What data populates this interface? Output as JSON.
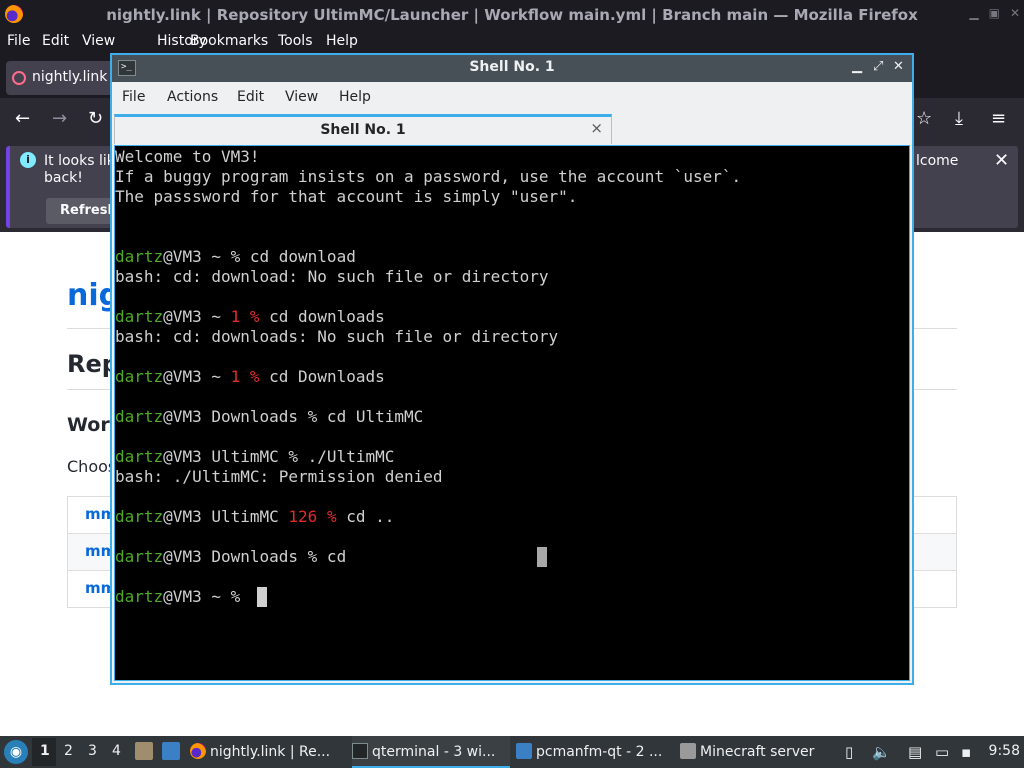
{
  "firefox": {
    "window_title": "nightly.link | Repository UltimMC/Launcher | Workflow main.yml | Branch main — Mozilla Firefox",
    "menu": [
      "File",
      "Edit",
      "View",
      "History",
      "Bookmarks",
      "Tools",
      "Help"
    ],
    "tab_label": "nightly.link |",
    "notice": {
      "text_line1": "It looks lik",
      "text_line2": "back!",
      "text_right": "lcome",
      "refresh_label": "Refresh"
    },
    "page": {
      "title": "nig",
      "repo_heading": "Rep",
      "workflow_heading": "Work",
      "choose_text": "Choos",
      "rows": [
        "mm",
        "mm",
        "mm"
      ]
    }
  },
  "terminal": {
    "window_title": "Shell No. 1",
    "menu": [
      "File",
      "Actions",
      "Edit",
      "View",
      "Help"
    ],
    "tab_label": "Shell No. 1",
    "tab_close": "×",
    "lines": [
      [
        {
          "t": "Welcome to VM3!",
          "k": "c"
        }
      ],
      [
        {
          "t": "If a buggy program insists on a password, use the account `user`.",
          "k": "c"
        }
      ],
      [
        {
          "t": "The passsword for that account is simply \"user\".",
          "k": "c"
        }
      ],
      [],
      [],
      [
        {
          "t": "dartz",
          "k": "u"
        },
        {
          "t": "@VM3 ~ % cd download",
          "k": "c"
        }
      ],
      [
        {
          "t": "bash: cd: download: No such file or directory",
          "k": "c"
        }
      ],
      [],
      [
        {
          "t": "dartz",
          "k": "u"
        },
        {
          "t": "@VM3 ~ ",
          "k": "c"
        },
        {
          "t": "1 %",
          "k": "e"
        },
        {
          "t": " cd downloads",
          "k": "c"
        }
      ],
      [
        {
          "t": "bash: cd: downloads: No such file or directory",
          "k": "c"
        }
      ],
      [],
      [
        {
          "t": "dartz",
          "k": "u"
        },
        {
          "t": "@VM3 ~ ",
          "k": "c"
        },
        {
          "t": "1 %",
          "k": "e"
        },
        {
          "t": " cd Downloads",
          "k": "c"
        }
      ],
      [],
      [
        {
          "t": "dartz",
          "k": "u"
        },
        {
          "t": "@VM3 Downloads % cd UltimMC",
          "k": "c"
        }
      ],
      [],
      [
        {
          "t": "dartz",
          "k": "u"
        },
        {
          "t": "@VM3 UltimMC % ./UltimMC",
          "k": "c"
        }
      ],
      [
        {
          "t": "bash: ./UltimMC: Permission denied",
          "k": "c"
        }
      ],
      [],
      [
        {
          "t": "dartz",
          "k": "u"
        },
        {
          "t": "@VM3 UltimMC ",
          "k": "c"
        },
        {
          "t": "126 %",
          "k": "e"
        },
        {
          "t": " cd ..",
          "k": "c"
        }
      ],
      [],
      [
        {
          "t": "dartz",
          "k": "u"
        },
        {
          "t": "@VM3 Downloads % cd",
          "k": "c"
        }
      ],
      [],
      [
        {
          "t": "dartz",
          "k": "u"
        },
        {
          "t": "@VM3 ~ % ",
          "k": "c"
        }
      ]
    ],
    "colors": {
      "user": "#4eaa25",
      "error_code": "#e02c2c",
      "text": "#d0d0d0",
      "background": "#000000"
    }
  },
  "taskbar": {
    "workspaces": [
      "1",
      "2",
      "3",
      "4"
    ],
    "active_workspace": "1",
    "tasks": [
      {
        "label": "nightly.link | Re...",
        "icon": "firefox-icon"
      },
      {
        "label": "qterminal - 3 wi...",
        "icon": "terminal-icon"
      },
      {
        "label": "pcmanfm-qt - 2 ...",
        "icon": "folder-icon"
      },
      {
        "label": "Minecraft server",
        "icon": "minecraft-icon"
      }
    ],
    "clock": "9:58"
  }
}
